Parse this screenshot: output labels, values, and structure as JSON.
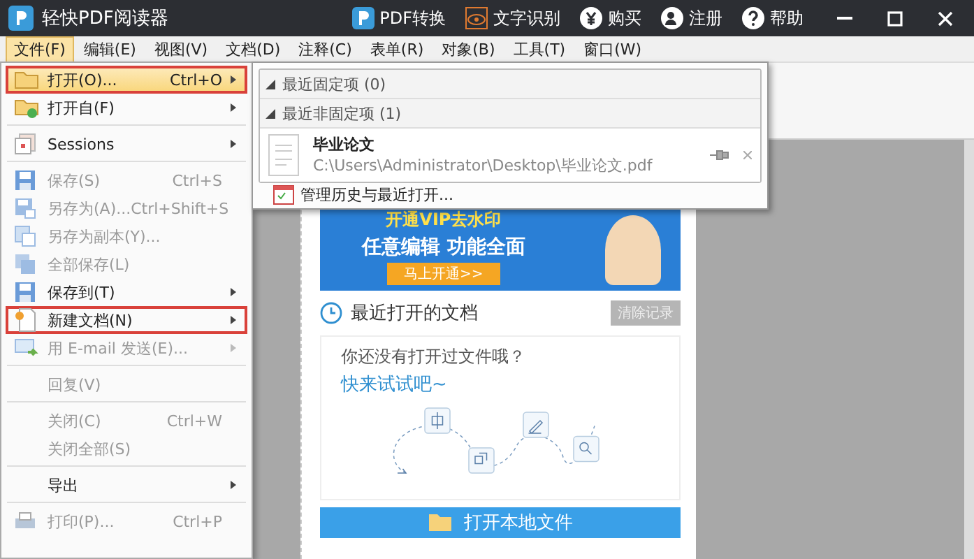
{
  "window": {
    "title": "轻快PDF阅读器"
  },
  "title_actions": [
    {
      "kind": "convert",
      "label": "PDF转换"
    },
    {
      "kind": "ocr",
      "label": "文字识别"
    },
    {
      "kind": "buy",
      "label": "购买"
    },
    {
      "kind": "register",
      "label": "注册"
    },
    {
      "kind": "help",
      "label": "帮助"
    }
  ],
  "menu_bar": [
    {
      "label": "文件(F)",
      "selected": true
    },
    {
      "label": "编辑(E)",
      "selected": false
    },
    {
      "label": "视图(V)",
      "selected": false
    },
    {
      "label": "文档(D)",
      "selected": false
    },
    {
      "label": "注释(C)",
      "selected": false
    },
    {
      "label": "表单(R)",
      "selected": false
    },
    {
      "label": "对象(B)",
      "selected": false
    },
    {
      "label": "工具(T)",
      "selected": false
    },
    {
      "label": "窗口(W)",
      "selected": false
    }
  ],
  "file_menu": {
    "items": [
      {
        "kind": "item",
        "label": "打开(O)...",
        "shortcut": "Ctrl+O",
        "submenu": true,
        "disabled": false,
        "selected": true,
        "highlighted": true
      },
      {
        "kind": "item",
        "label": "打开自(F)",
        "submenu": true,
        "disabled": false,
        "selected": false,
        "highlighted": false
      },
      {
        "kind": "separator"
      },
      {
        "kind": "item",
        "label": "Sessions",
        "submenu": true,
        "disabled": false,
        "selected": false,
        "highlighted": false
      },
      {
        "kind": "separator"
      },
      {
        "kind": "item",
        "label": "保存(S)",
        "shortcut": "Ctrl+S",
        "submenu": false,
        "disabled": true,
        "selected": false,
        "highlighted": false
      },
      {
        "kind": "item",
        "label": "另存为(A)...",
        "shortcut": "Ctrl+Shift+S",
        "submenu": false,
        "disabled": true,
        "selected": false,
        "highlighted": false
      },
      {
        "kind": "item",
        "label": "另存为副本(Y)...",
        "submenu": false,
        "disabled": true,
        "selected": false,
        "highlighted": false
      },
      {
        "kind": "item",
        "label": "全部保存(L)",
        "submenu": false,
        "disabled": true,
        "selected": false,
        "highlighted": false
      },
      {
        "kind": "item",
        "label": "保存到(T)",
        "submenu": true,
        "disabled": false,
        "selected": false,
        "highlighted": false
      },
      {
        "kind": "item",
        "label": "新建文档(N)",
        "submenu": true,
        "disabled": false,
        "selected": false,
        "highlighted": true
      },
      {
        "kind": "item",
        "label": "用 E-mail 发送(E)...",
        "submenu": true,
        "disabled": true,
        "selected": false,
        "highlighted": false
      },
      {
        "kind": "separator"
      },
      {
        "kind": "item",
        "label": "回复(V)",
        "submenu": false,
        "disabled": true,
        "selected": false,
        "highlighted": false
      },
      {
        "kind": "separator"
      },
      {
        "kind": "item",
        "label": "关闭(C)",
        "shortcut": "Ctrl+W",
        "submenu": false,
        "disabled": true,
        "selected": false,
        "highlighted": false
      },
      {
        "kind": "item",
        "label": "关闭全部(S)",
        "submenu": false,
        "disabled": true,
        "selected": false,
        "highlighted": false
      },
      {
        "kind": "separator"
      },
      {
        "kind": "item",
        "label": "导出",
        "submenu": true,
        "disabled": false,
        "selected": false,
        "highlighted": false
      },
      {
        "kind": "separator"
      },
      {
        "kind": "item",
        "label": "打印(P)...",
        "shortcut": "Ctrl+P",
        "submenu": false,
        "disabled": true,
        "selected": false,
        "highlighted": false
      }
    ]
  },
  "recent_submenu": {
    "sections": [
      {
        "label": "最近固定项 (0)",
        "expanded": true
      },
      {
        "label": "最近非固定项 (1)",
        "expanded": true,
        "files": [
          {
            "name": "毕业论文",
            "path": "C:\\Users\\Administrator\\Desktop\\毕业论文.pdf"
          }
        ]
      }
    ],
    "footer": "管理历史与最近打开..."
  },
  "start_page": {
    "banner": {
      "headline": "开通VIP去水印",
      "tagline": "任意编辑  功能全面",
      "button": "马上开通>>"
    },
    "recent_title": "最近打开的文档",
    "clear_button": "清除记录",
    "empty_message": "你还没有打开过文件哦？",
    "empty_prompt": "快来试试吧~",
    "open_button": "打开本地文件"
  }
}
